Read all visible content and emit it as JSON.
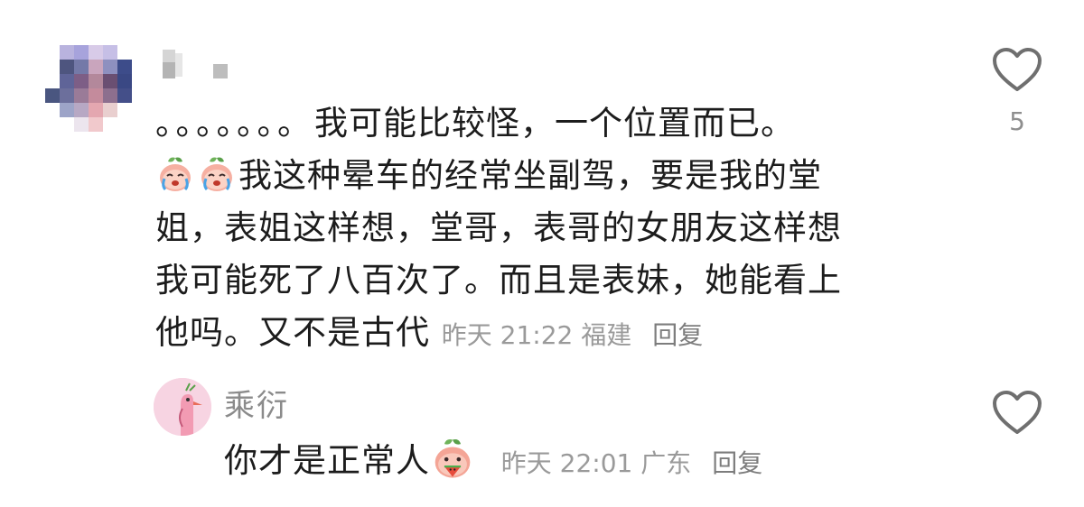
{
  "comment": {
    "dots": "。。。。。。。",
    "lines": [
      "我可能比较怪，一个位置而已。",
      "我这种晕车的经常坐副驾，要是我的堂",
      "姐，表姐这样想，堂哥，表哥的女朋友这样想",
      "我可能死了八百次了。而且是表妹，她能看上",
      "他吗。又不是古代"
    ],
    "time": "昨天 21:22",
    "location": "福建",
    "reply_label": "回复",
    "like_count": "5",
    "emoji_name": "crying-peach-emoji"
  },
  "reply": {
    "username": "乘衍",
    "text": "你才是正常人",
    "time": "昨天 22:01",
    "location": "广东",
    "reply_label": "回复",
    "emoji_name": "eating-watermelon-peach-emoji"
  },
  "colors": {
    "text": "#1c1c1c",
    "meta": "#9a9a9a",
    "heart": "#6f6f6f",
    "reply_avatar_bg": "#f7d4e2"
  }
}
